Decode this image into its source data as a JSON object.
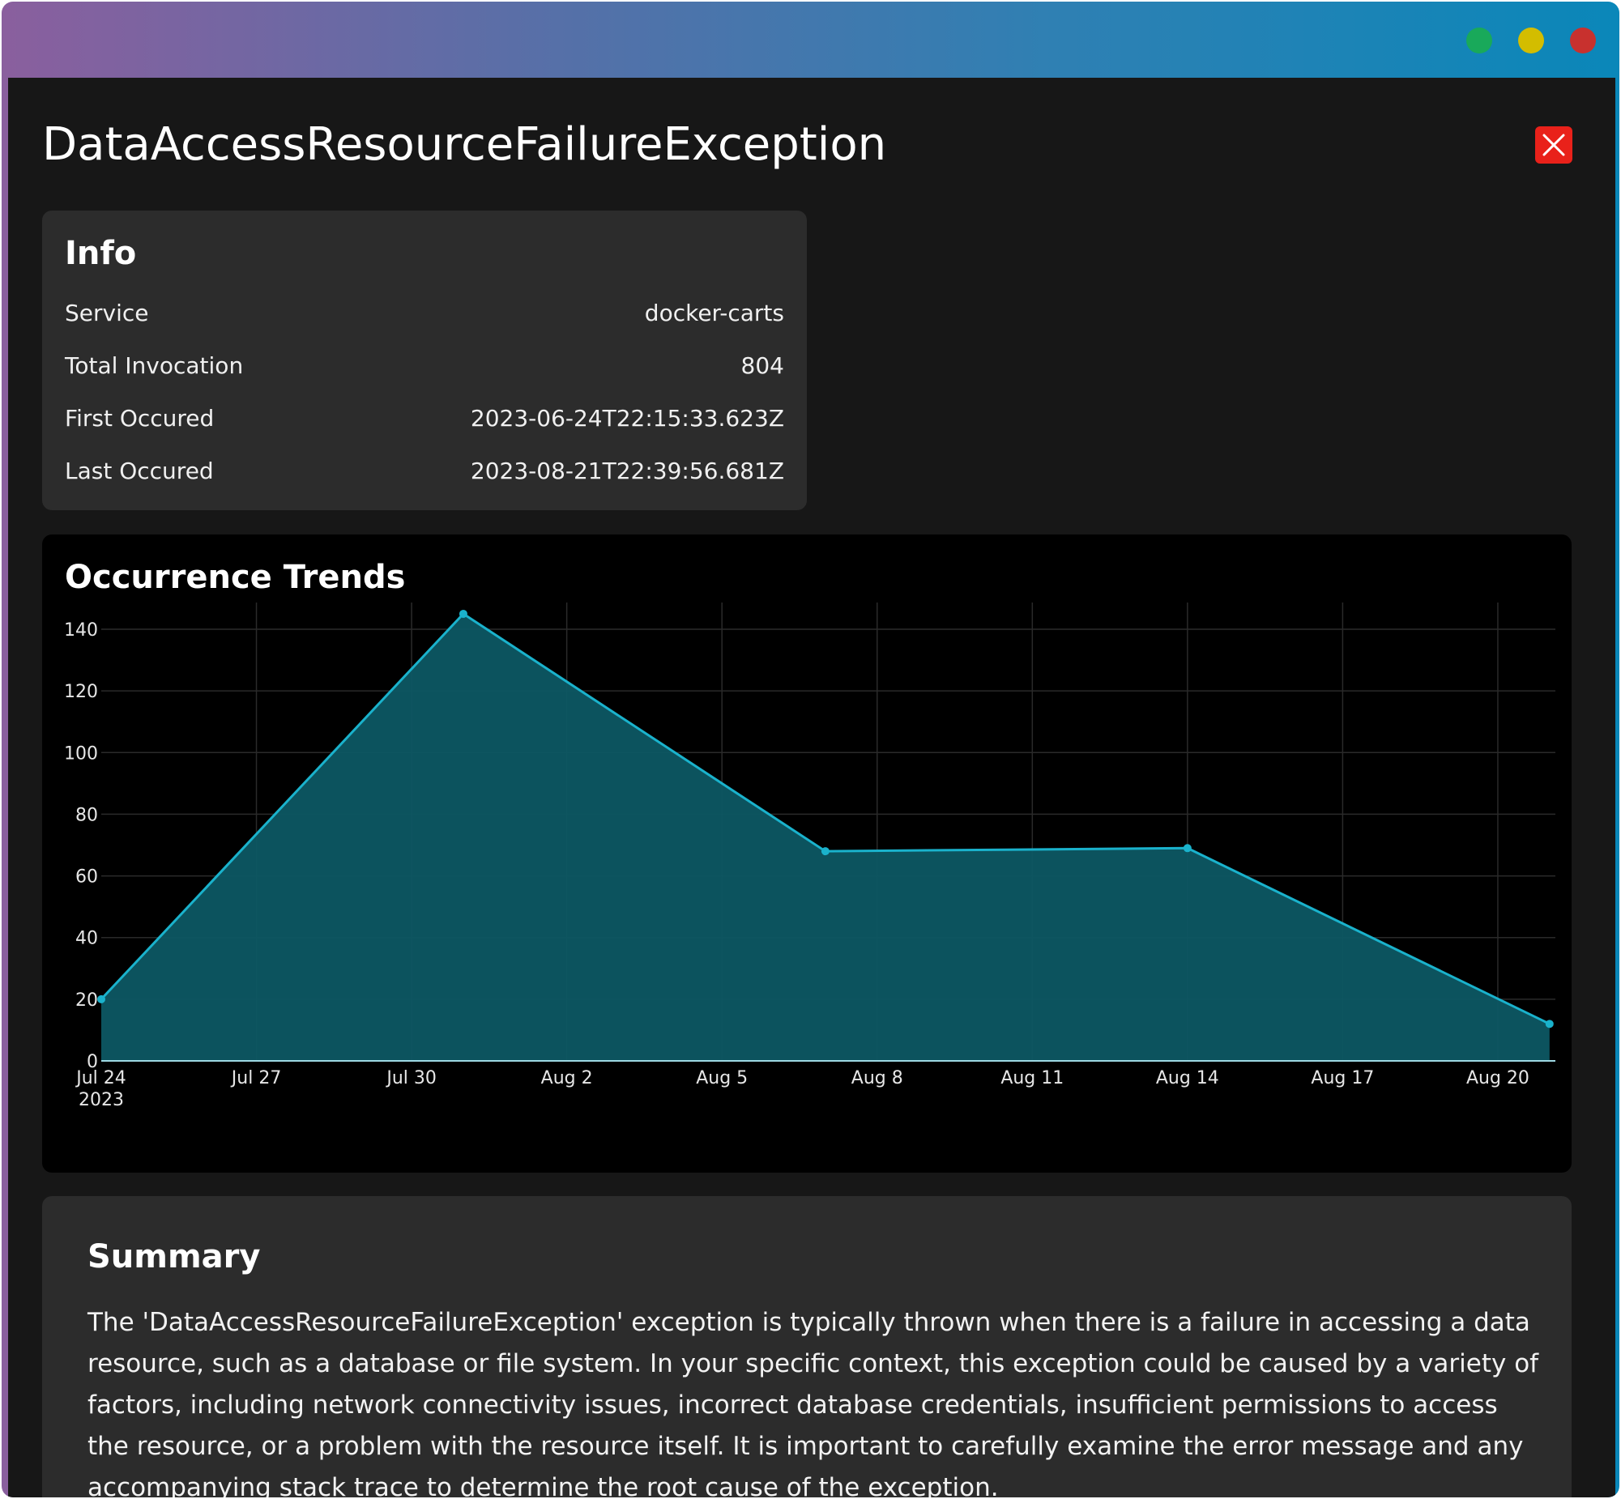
{
  "window": {
    "controls": [
      "green-dot",
      "yellow-dot",
      "red-dot"
    ]
  },
  "header": {
    "title": "DataAccessResourceFailureException",
    "close_icon": "close-icon",
    "close_color": "#e9211a"
  },
  "info": {
    "title": "Info",
    "rows": [
      {
        "label": "Service",
        "value": "docker-carts"
      },
      {
        "label": "Total Invocation",
        "value": "804"
      },
      {
        "label": "First Occured",
        "value": "2023-06-24T22:15:33.623Z"
      },
      {
        "label": "Last Occured",
        "value": "2023-08-21T22:39:56.681Z"
      }
    ]
  },
  "trends": {
    "title": "Occurrence Trends"
  },
  "chart_data": {
    "type": "area",
    "x": [
      "2023-07-24",
      "2023-07-31",
      "2023-08-07",
      "2023-08-14",
      "2023-08-21"
    ],
    "values": [
      20,
      145,
      68,
      69,
      12
    ],
    "ylim": [
      0,
      152
    ],
    "yticks": [
      0,
      20,
      40,
      60,
      80,
      100,
      120,
      140
    ],
    "xticks": [
      "Jul 24",
      "Jul 27",
      "Jul 30",
      "Aug 2",
      "Aug 5",
      "Aug 8",
      "Aug 11",
      "Aug 14",
      "Aug 17",
      "Aug 20"
    ],
    "xtick_year": "2023",
    "grid": true,
    "line_color": "#1ab2cc",
    "fill_color": "#0d5763"
  },
  "summary": {
    "title": "Summary",
    "text": "The 'DataAccessResourceFailureException' exception is typically thrown when there is a failure in accessing a data resource, such as a database or file system. In your specific context, this exception could be caused by a variety of factors, including network connectivity issues, incorrect database credentials, insufficient permissions to access the resource, or a problem with the resource itself. It is important to carefully examine the error message and any accompanying stack trace to determine the root cause of the exception."
  }
}
